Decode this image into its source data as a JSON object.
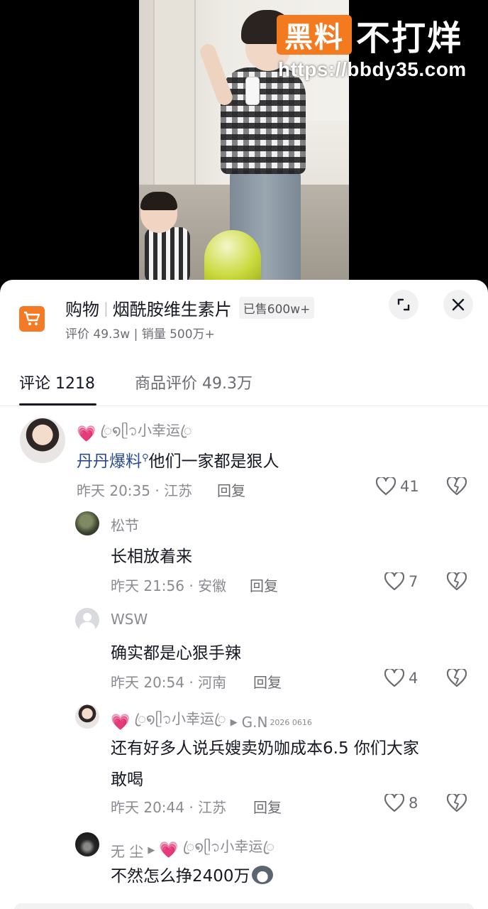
{
  "watermark": {
    "logo_text": "黑料",
    "slogan": "不打烊",
    "url": "https://bbdy35.com"
  },
  "product": {
    "section": "购物",
    "name": "烟酰胺维生素片",
    "sold_badge": "已售600w+",
    "stats": "评价 49.3w | 销量 500万+",
    "icon": "shopping-cart-icon",
    "accent": "#f47a25"
  },
  "tabs": [
    {
      "label": "评论 1218",
      "active": true
    },
    {
      "label": "商品评价 49.3万",
      "active": false
    }
  ],
  "comments": [
    {
      "user": "ꦿ໑ᥫ᭡小幸运ꦿ",
      "mention": "丹丹爆料",
      "text": "他们一家都是狠人",
      "time_loc": "昨天 20:35 · 江苏",
      "reply_label": "回复",
      "likes": "41"
    },
    {
      "user": "松节",
      "text": "长相放着来",
      "time_loc": "昨天 21:56 · 安徽",
      "reply_label": "回复",
      "likes": "7"
    },
    {
      "user": "WSW",
      "text": "确实都是心狠手辣",
      "time_loc": "昨天 20:54 · 河南",
      "reply_label": "回复",
      "likes": "4"
    },
    {
      "user": "ꦿ໑ᥫ᭡小幸运ꦿ",
      "reply_to": "G.N",
      "reply_to_sup": "2026 0616",
      "text_line1": "还有好多人说兵嫂卖奶咖成本6.5 你们大家",
      "text_line2": "敢喝",
      "time_loc": "昨天 20:44 · 江苏",
      "reply_label": "回复",
      "likes": "8"
    },
    {
      "user": "无 尘",
      "reply_to": "ꦿ໑ᥫ᭡小幸运ꦿ",
      "text": "不然怎么挣2400万"
    }
  ]
}
